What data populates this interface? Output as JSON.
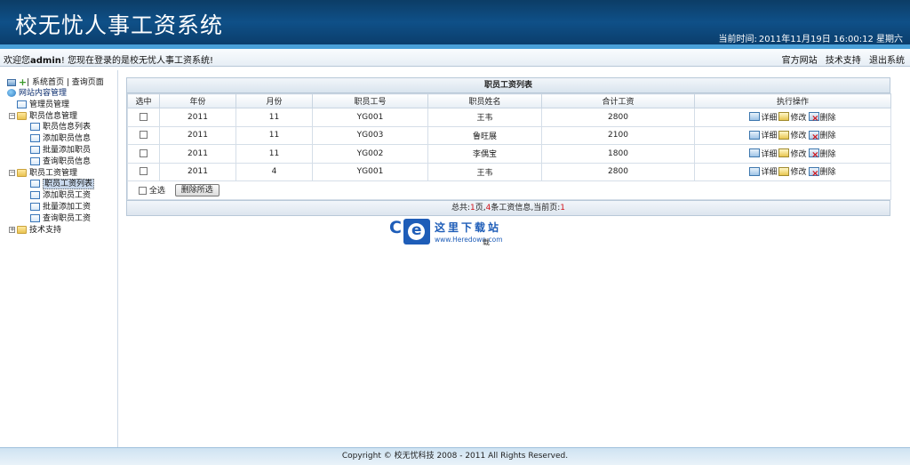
{
  "header": {
    "title": "校无忧人事工资系统",
    "clock_label": "当前时间:",
    "clock_value": "2011年11月19日 16:00:12 星期六"
  },
  "welcome": {
    "prefix": "欢迎您",
    "user": "admin",
    "suffix": "! 您现在登录的是校无忧人事工资系统!",
    "links": [
      "官方网站",
      "技术支持",
      "退出系统"
    ]
  },
  "sidebar": {
    "top_links": [
      "系统首页",
      "查询页面"
    ],
    "tree": [
      {
        "label": "网站内容管理",
        "level": 0,
        "type": "root"
      },
      {
        "label": "管理员管理",
        "level": 1,
        "type": "page"
      },
      {
        "label": "职员信息管理",
        "level": 1,
        "type": "folder",
        "expander": "−"
      },
      {
        "label": "职员信息列表",
        "level": 2,
        "type": "page"
      },
      {
        "label": "添加职员信息",
        "level": 2,
        "type": "page"
      },
      {
        "label": "批量添加职员",
        "level": 2,
        "type": "page"
      },
      {
        "label": "查询职员信息",
        "level": 2,
        "type": "page"
      },
      {
        "label": "职员工资管理",
        "level": 1,
        "type": "folder",
        "expander": "−"
      },
      {
        "label": "职员工资列表",
        "level": 2,
        "type": "page",
        "selected": true
      },
      {
        "label": "添加职员工资",
        "level": 2,
        "type": "page"
      },
      {
        "label": "批量添加工资",
        "level": 2,
        "type": "page"
      },
      {
        "label": "查询职员工资",
        "level": 2,
        "type": "page"
      },
      {
        "label": "技术支持",
        "level": 1,
        "type": "folder",
        "expander": "+"
      }
    ]
  },
  "grid": {
    "title": "职员工资列表",
    "columns": [
      "选中",
      "年份",
      "月份",
      "职员工号",
      "职员姓名",
      "合计工资",
      "执行操作"
    ],
    "rows": [
      {
        "year": "2011",
        "month": "11",
        "id": "YG001",
        "name": "王韦",
        "total": "2800"
      },
      {
        "year": "2011",
        "month": "11",
        "id": "YG003",
        "name": "鲁旺展",
        "total": "2100"
      },
      {
        "year": "2011",
        "month": "11",
        "id": "YG002",
        "name": "李偶宝",
        "total": "1800"
      },
      {
        "year": "2011",
        "month": "4",
        "id": "YG001",
        "name": "王韦",
        "total": "2800"
      }
    ],
    "actions": {
      "detail": "详细",
      "edit": "修改",
      "delete": "删除"
    },
    "select_all": "全选",
    "delete_selected": "删除所选"
  },
  "pager": {
    "t1": "总共:",
    "pages": "1",
    "t2": "页,",
    "count": "4",
    "t3": "条工资信息,当前页:",
    "current": "1"
  },
  "watermark": {
    "big": "C",
    "cn": "这里下载站",
    "url": "www.Heredown.com",
    "tail": "载"
  },
  "footer": {
    "text": "Copyright © 校无忧科技 2008 - 2011 All Rights Reserved."
  }
}
